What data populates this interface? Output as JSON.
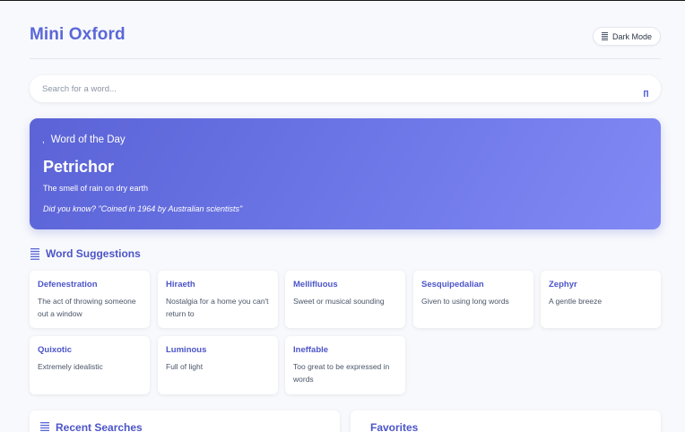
{
  "app": {
    "title": "Mini Oxford"
  },
  "header": {
    "dark_mode_label": "Dark Mode",
    "dark_mode_icon": "theme-icon"
  },
  "search": {
    "placeholder": "Search for a word...",
    "value": "",
    "icon": "search-icon"
  },
  "word_of_day": {
    "label": "Word of the Day",
    "word": "Petrichor",
    "definition": "The smell of rain on dry earth",
    "fact": "Did you know? \"Coined in 1964 by Australian scientists\""
  },
  "suggestions": {
    "title": "Word Suggestions",
    "items": [
      {
        "word": "Defenestration",
        "definition": "The act of throwing someone out a window"
      },
      {
        "word": "Hiraeth",
        "definition": "Nostalgia for a home you can't return to"
      },
      {
        "word": "Mellifluous",
        "definition": "Sweet or musical sounding"
      },
      {
        "word": "Sesquipedalian",
        "definition": "Given to using long words"
      },
      {
        "word": "Zephyr",
        "definition": "A gentle breeze"
      },
      {
        "word": "Quixotic",
        "definition": "Extremely idealistic"
      },
      {
        "word": "Luminous",
        "definition": "Full of light"
      },
      {
        "word": "Ineffable",
        "definition": "Too great to be expressed in words"
      }
    ]
  },
  "recent": {
    "title": "Recent Searches"
  },
  "favorites": {
    "title": "Favorites"
  },
  "colors": {
    "accent": "#5a67d8",
    "gradient_start": "#5b63d6",
    "gradient_end": "#8189f5"
  }
}
